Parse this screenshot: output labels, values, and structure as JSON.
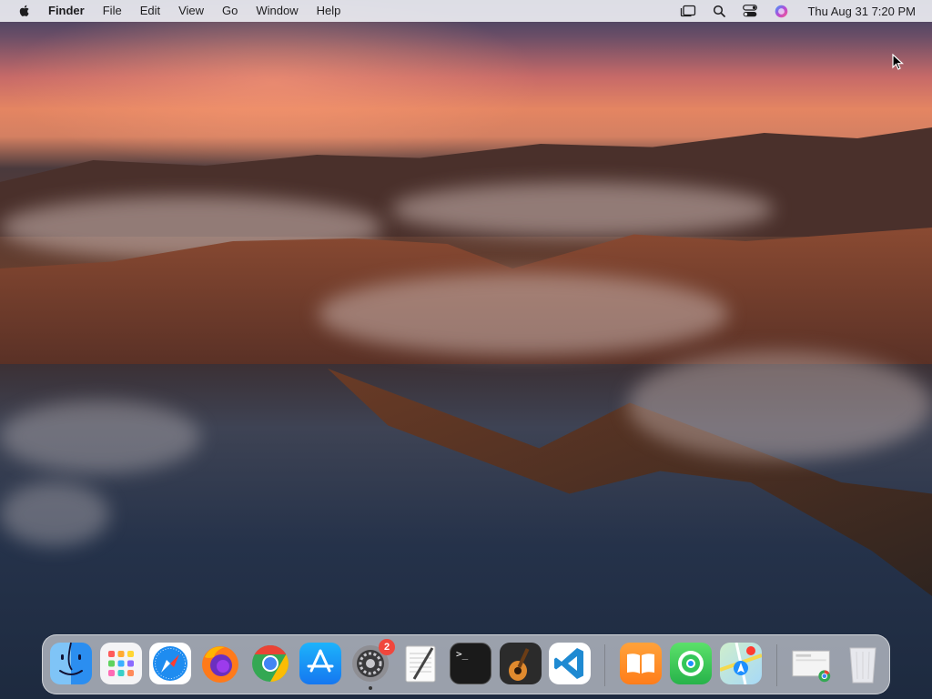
{
  "menubar": {
    "app_name": "Finder",
    "items": [
      "File",
      "Edit",
      "View",
      "Go",
      "Window",
      "Help"
    ],
    "status_icons": [
      "stage-manager-icon",
      "spotlight-search-icon",
      "control-center-icon",
      "siri-icon"
    ],
    "clock": "Thu Aug 31  7:20 PM"
  },
  "dock": {
    "apps": [
      {
        "name": "Finder",
        "icon": "finder-icon",
        "running": true
      },
      {
        "name": "Launchpad",
        "icon": "launchpad-icon",
        "running": false
      },
      {
        "name": "Safari",
        "icon": "safari-icon",
        "running": false
      },
      {
        "name": "Firefox",
        "icon": "firefox-icon",
        "running": false
      },
      {
        "name": "Google Chrome",
        "icon": "chrome-icon",
        "running": true
      },
      {
        "name": "App Store",
        "icon": "app-store-icon",
        "running": false
      },
      {
        "name": "System Settings",
        "icon": "system-settings-icon",
        "running": true,
        "badge": "2"
      },
      {
        "name": "TextEdit",
        "icon": "textedit-icon",
        "running": false
      },
      {
        "name": "Terminal",
        "icon": "terminal-icon",
        "running": false
      },
      {
        "name": "GarageBand",
        "icon": "garageband-icon",
        "running": false
      },
      {
        "name": "Visual Studio Code",
        "icon": "vscode-icon",
        "running": false
      },
      {
        "name": "Books",
        "icon": "books-icon",
        "running": true
      },
      {
        "name": "Find My",
        "icon": "find-my-icon",
        "running": false
      },
      {
        "name": "Maps",
        "icon": "maps-icon",
        "running": true
      },
      {
        "name": "Downloads",
        "icon": "downloads-stack-icon",
        "running": false
      },
      {
        "name": "Trash",
        "icon": "trash-icon",
        "running": false
      }
    ],
    "terminal_glyph": ">_"
  }
}
